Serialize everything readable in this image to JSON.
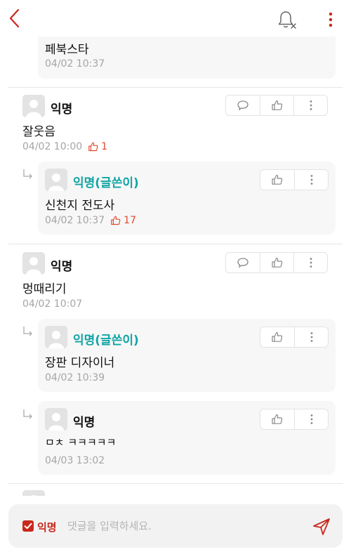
{
  "header": {
    "back_icon": "back-chevron-icon",
    "bell_icon": "notification-off-icon",
    "menu_icon": "more-vertical-icon",
    "accent_color": "#c8291c"
  },
  "comments": [
    {
      "partial": true,
      "replies": [
        {
          "text": "페북스타",
          "time": "04/02 10:37"
        }
      ]
    },
    {
      "author": "익명",
      "text": "잘웃음",
      "time": "04/02 10:00",
      "likes": "1",
      "replies": [
        {
          "author": "익명(글쓴이)",
          "is_op": true,
          "text": "신천지 전도사",
          "time": "04/02 10:37",
          "likes": "17"
        }
      ]
    },
    {
      "author": "익명",
      "text": "멍때리기",
      "time": "04/02 10:07",
      "replies": [
        {
          "author": "익명(글쓴이)",
          "is_op": true,
          "text": "장판 디자이너",
          "time": "04/02 10:39"
        },
        {
          "author": "익명",
          "is_op": false,
          "text": "ㅁㅊ ㅋㅋㅋㅋㅋ",
          "time": "04/03 13:02"
        }
      ]
    }
  ],
  "composer": {
    "anonymous_label": "익명",
    "anonymous_checked": true,
    "placeholder": "댓글을 입력하세요.",
    "send_icon": "send-icon"
  }
}
